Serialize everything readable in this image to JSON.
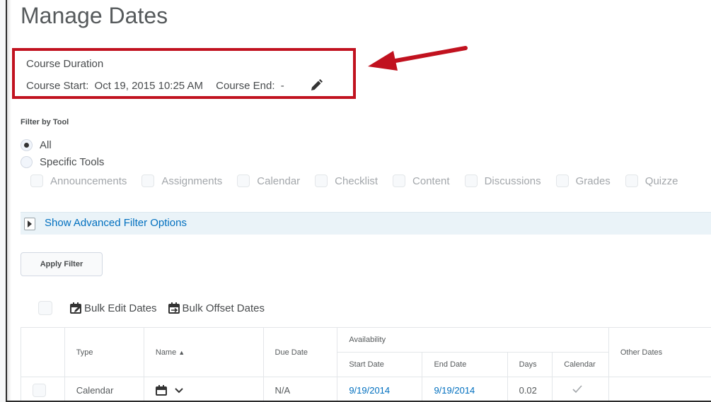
{
  "page": {
    "title": "Manage Dates"
  },
  "course_duration": {
    "label": "Course Duration",
    "start_label": "Course Start:",
    "start_value": "Oct 19, 2015 10:25 AM",
    "end_label": "Course End:",
    "end_value": "-",
    "edit_icon": "pencil-icon",
    "highlight_color": "#c1121f"
  },
  "filter": {
    "title": "Filter by Tool",
    "options": [
      {
        "label": "All",
        "selected": true
      },
      {
        "label": "Specific Tools",
        "selected": false
      }
    ],
    "tools": [
      "Announcements",
      "Assignments",
      "Calendar",
      "Checklist",
      "Content",
      "Discussions",
      "Grades",
      "Quizze"
    ]
  },
  "advanced_filter": {
    "label": "Show Advanced Filter Options"
  },
  "apply_filter": {
    "label": "Apply Filter"
  },
  "bulk_actions": {
    "edit_label": "Bulk Edit Dates",
    "offset_label": "Bulk Offset Dates"
  },
  "table": {
    "headers": {
      "type": "Type",
      "name": "Name",
      "due_date": "Due Date",
      "availability": "Availability",
      "start_date": "Start Date",
      "end_date": "End Date",
      "days": "Days",
      "calendar": "Calendar",
      "other_dates": "Other Dates"
    },
    "rows": [
      {
        "type": "Calendar",
        "due_date": "N/A",
        "start_date": "9/19/2014",
        "end_date": "9/19/2014",
        "days": "0.02",
        "calendar": true
      }
    ]
  },
  "colors": {
    "link": "#006fbf",
    "accent_bar": "#eaf3f8"
  }
}
